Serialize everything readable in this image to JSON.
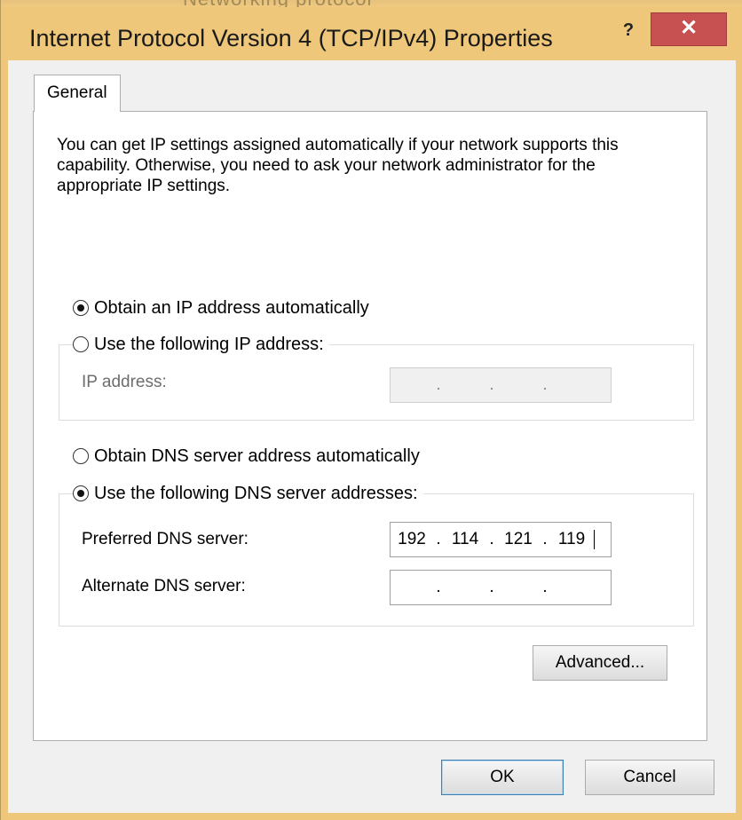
{
  "background_window": {
    "ghost_title": "Networking protocol"
  },
  "window": {
    "title": "Internet Protocol Version 4 (TCP/IPv4) Properties",
    "help_glyph": "?",
    "close_glyph": "✕"
  },
  "tabs": [
    {
      "label": "General",
      "selected": true
    }
  ],
  "general": {
    "description": "You can get IP settings assigned automatically if your network supports this capability. Otherwise, you need to ask your network administrator for the appropriate IP settings.",
    "ip": {
      "auto_label": "Obtain an IP address automatically",
      "manual_label": "Use the following IP address:",
      "auto_selected": true,
      "ip_address_label": "IP address:",
      "ip_address_value": [
        "",
        "",
        "",
        ""
      ]
    },
    "dns": {
      "auto_label": "Obtain DNS server address automatically",
      "manual_label": "Use the following DNS server addresses:",
      "manual_selected": true,
      "preferred_label": "Preferred DNS server:",
      "preferred_value": [
        "192",
        "114",
        "121",
        "119"
      ],
      "alternate_label": "Alternate DNS server:",
      "alternate_value": [
        "",
        "",
        "",
        ""
      ]
    },
    "advanced_label": "Advanced..."
  },
  "footer": {
    "ok_label": "OK",
    "cancel_label": "Cancel"
  },
  "colors": {
    "frame": "#eec77a",
    "close_button": "#c75050",
    "client": "#f0f0f0",
    "panel": "#ffffff"
  }
}
